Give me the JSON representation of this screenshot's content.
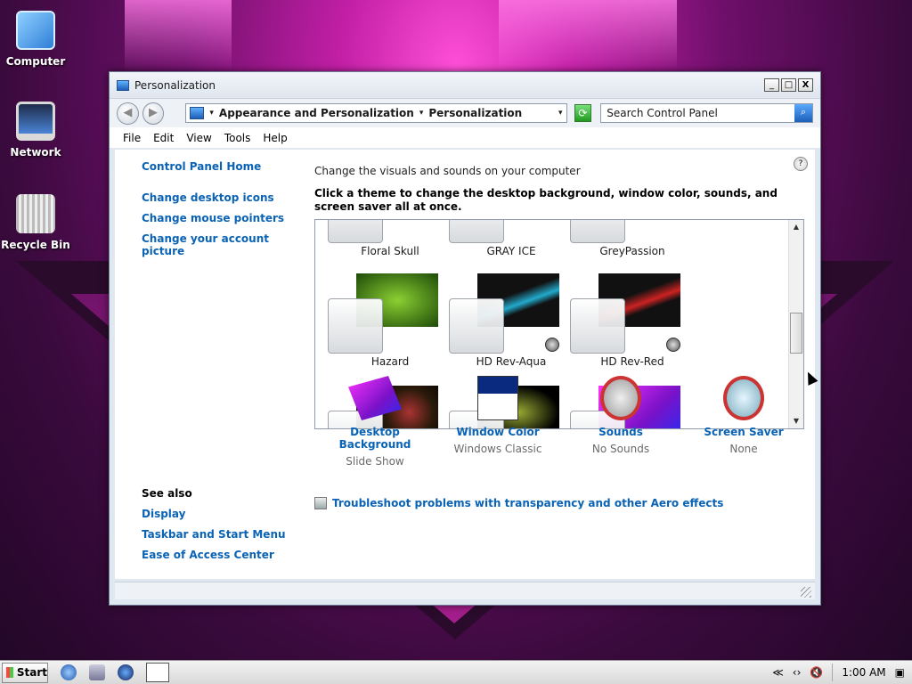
{
  "desktop": {
    "icons": [
      {
        "label": "Computer"
      },
      {
        "label": "Network"
      },
      {
        "label": "Recycle Bin"
      }
    ]
  },
  "window": {
    "title": "Personalization",
    "controls": {
      "minimize": "_",
      "maximize": "□",
      "close": "X"
    },
    "nav": {
      "back": "◀",
      "forward": "▶"
    },
    "address": {
      "crumb1": "Appearance and Personalization",
      "crumb2": "Personalization",
      "sep": "▾"
    },
    "search": {
      "placeholder": "Search Control Panel"
    },
    "menu": [
      "File",
      "Edit",
      "View",
      "Tools",
      "Help"
    ]
  },
  "sidebar": {
    "home": "Control Panel Home",
    "links": [
      "Change desktop icons",
      "Change mouse pointers",
      "Change your account picture"
    ],
    "see_also_heading": "See also",
    "see_also": [
      "Display",
      "Taskbar and Start Menu",
      "Ease of Access Center"
    ]
  },
  "main": {
    "heading": "Change the visuals and sounds on your computer",
    "subheading": "Click a theme to change the desktop background, window color, sounds, and screen saver all at once."
  },
  "themes": [
    {
      "name": "Floral Skull",
      "wall": "#dcdcdc"
    },
    {
      "name": "GRAY ICE",
      "wall": "#e4eef8"
    },
    {
      "name": "GreyPassion",
      "wall": "#444"
    },
    {
      "name": "Hazard",
      "wall": "#3d7a10"
    },
    {
      "name": "HD Rev-Aqua",
      "wall": "#111"
    },
    {
      "name": "HD Rev-Red",
      "wall": "#111"
    },
    {
      "name": "",
      "wall": "#2a1a0a"
    },
    {
      "name": "",
      "wall": "#3a4a0a"
    },
    {
      "name": "",
      "wall": "#c21ad6"
    }
  ],
  "customize": [
    {
      "title": "Desktop Background",
      "value": "Slide Show"
    },
    {
      "title": "Window Color",
      "value": "Windows Classic"
    },
    {
      "title": "Sounds",
      "value": "No Sounds"
    },
    {
      "title": "Screen Saver",
      "value": "None"
    }
  ],
  "troubleshoot": "Troubleshoot problems with transparency and other Aero effects",
  "taskbar": {
    "start": "Start",
    "clock": "1:00 AM"
  }
}
